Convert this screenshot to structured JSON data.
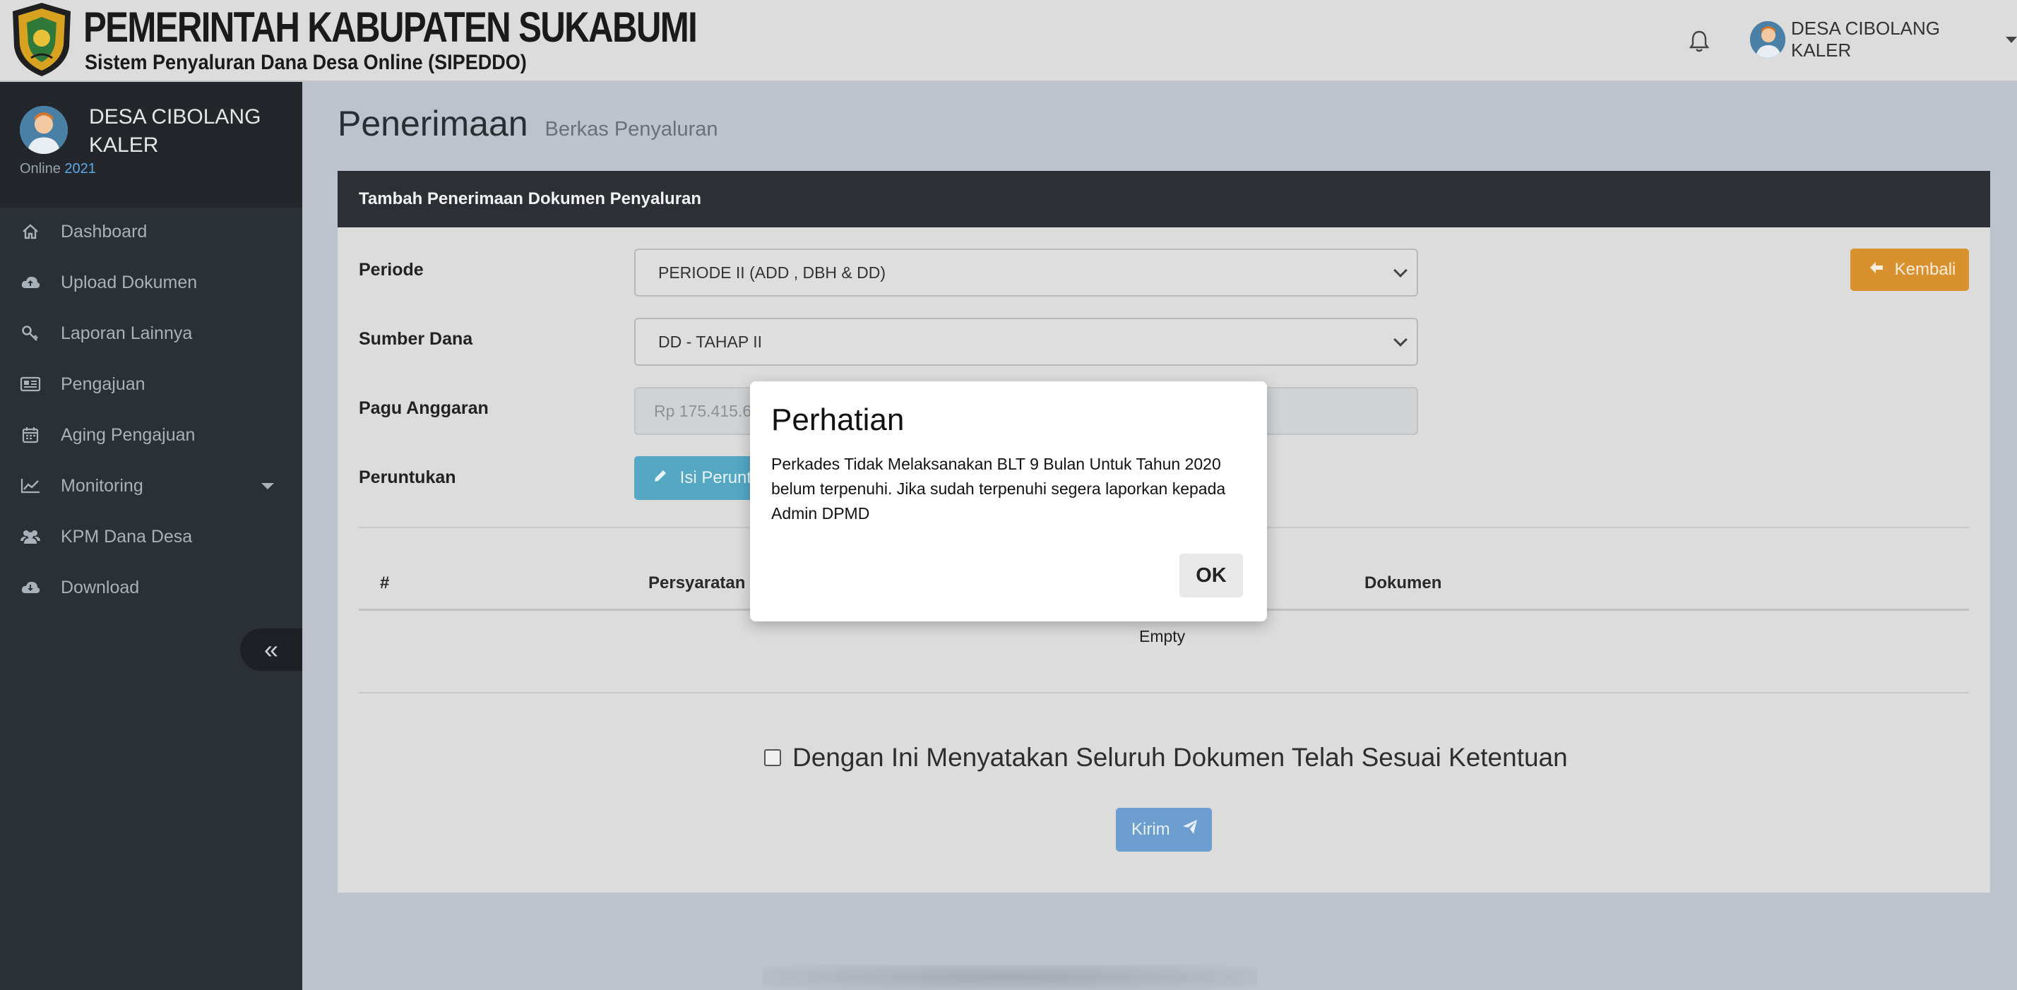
{
  "header": {
    "title": "PEMERINTAH KABUPATEN SUKABUMI",
    "subtitle": "Sistem Penyaluran Dana Desa Online (SIPEDDO)",
    "user_name": "DESA CIBOLANG KALER",
    "icons": {
      "logo": "coat-of-arms-logo",
      "notification": "bell-icon"
    }
  },
  "sidebar": {
    "profile_name": "DESA CIBOLANG KALER",
    "status_label": "Online",
    "status_year": "2021",
    "items": [
      {
        "label": "Dashboard",
        "icon": "home-icon"
      },
      {
        "label": "Upload Dokumen",
        "icon": "cloud-upload-icon"
      },
      {
        "label": "Laporan Lainnya",
        "icon": "key-icon"
      },
      {
        "label": "Pengajuan",
        "icon": "newspaper-icon"
      },
      {
        "label": "Aging Pengajuan",
        "icon": "calendar-icon"
      },
      {
        "label": "Monitoring",
        "icon": "line-chart-icon"
      },
      {
        "label": "KPM Dana Desa",
        "icon": "users-icon"
      },
      {
        "label": "Download",
        "icon": "cloud-download-icon"
      }
    ],
    "collapse_label": "«"
  },
  "page": {
    "title": "Penerimaan",
    "subtitle": "Berkas Penyaluran"
  },
  "panel": {
    "heading": "Tambah Penerimaan Dokumen Penyaluran",
    "periode_label": "Periode",
    "periode_value": "PERIODE II (ADD , DBH & DD)",
    "sumber_label": "Sumber Dana",
    "sumber_value": "DD - TAHAP II",
    "pagu_label": "Pagu Anggaran",
    "pagu_value": "Rp 175.415.6",
    "peruntukan_label": "Peruntukan",
    "isi_button": "Isi Peruntukan",
    "kembali_button": "Kembali",
    "table": {
      "columns": [
        "#",
        "Persyaratan",
        "Dokumen"
      ],
      "empty_text": "Empty"
    },
    "confirm_text": "Dengan Ini Menyatakan Seluruh Dokumen Telah Sesuai Ketentuan",
    "kirim_button": "Kirim"
  },
  "modal": {
    "title": "Perhatian",
    "message": "Perkades Tidak Melaksanakan BLT 9 Bulan Untuk Tahun 2020 belum terpenuhi. Jika sudah terpenuhi segera laporkan kepada Admin DPMD",
    "ok_button": "OK"
  },
  "colors": {
    "header_bg": "#dcdcdc",
    "sidebar_bg": "#2b3036",
    "panel_head_bg": "#2c3035",
    "info_button": "#55a7c4",
    "warning_button": "#d9902e",
    "primary_button": "#6c9fd0",
    "year_accent": "#5aa9e6"
  }
}
